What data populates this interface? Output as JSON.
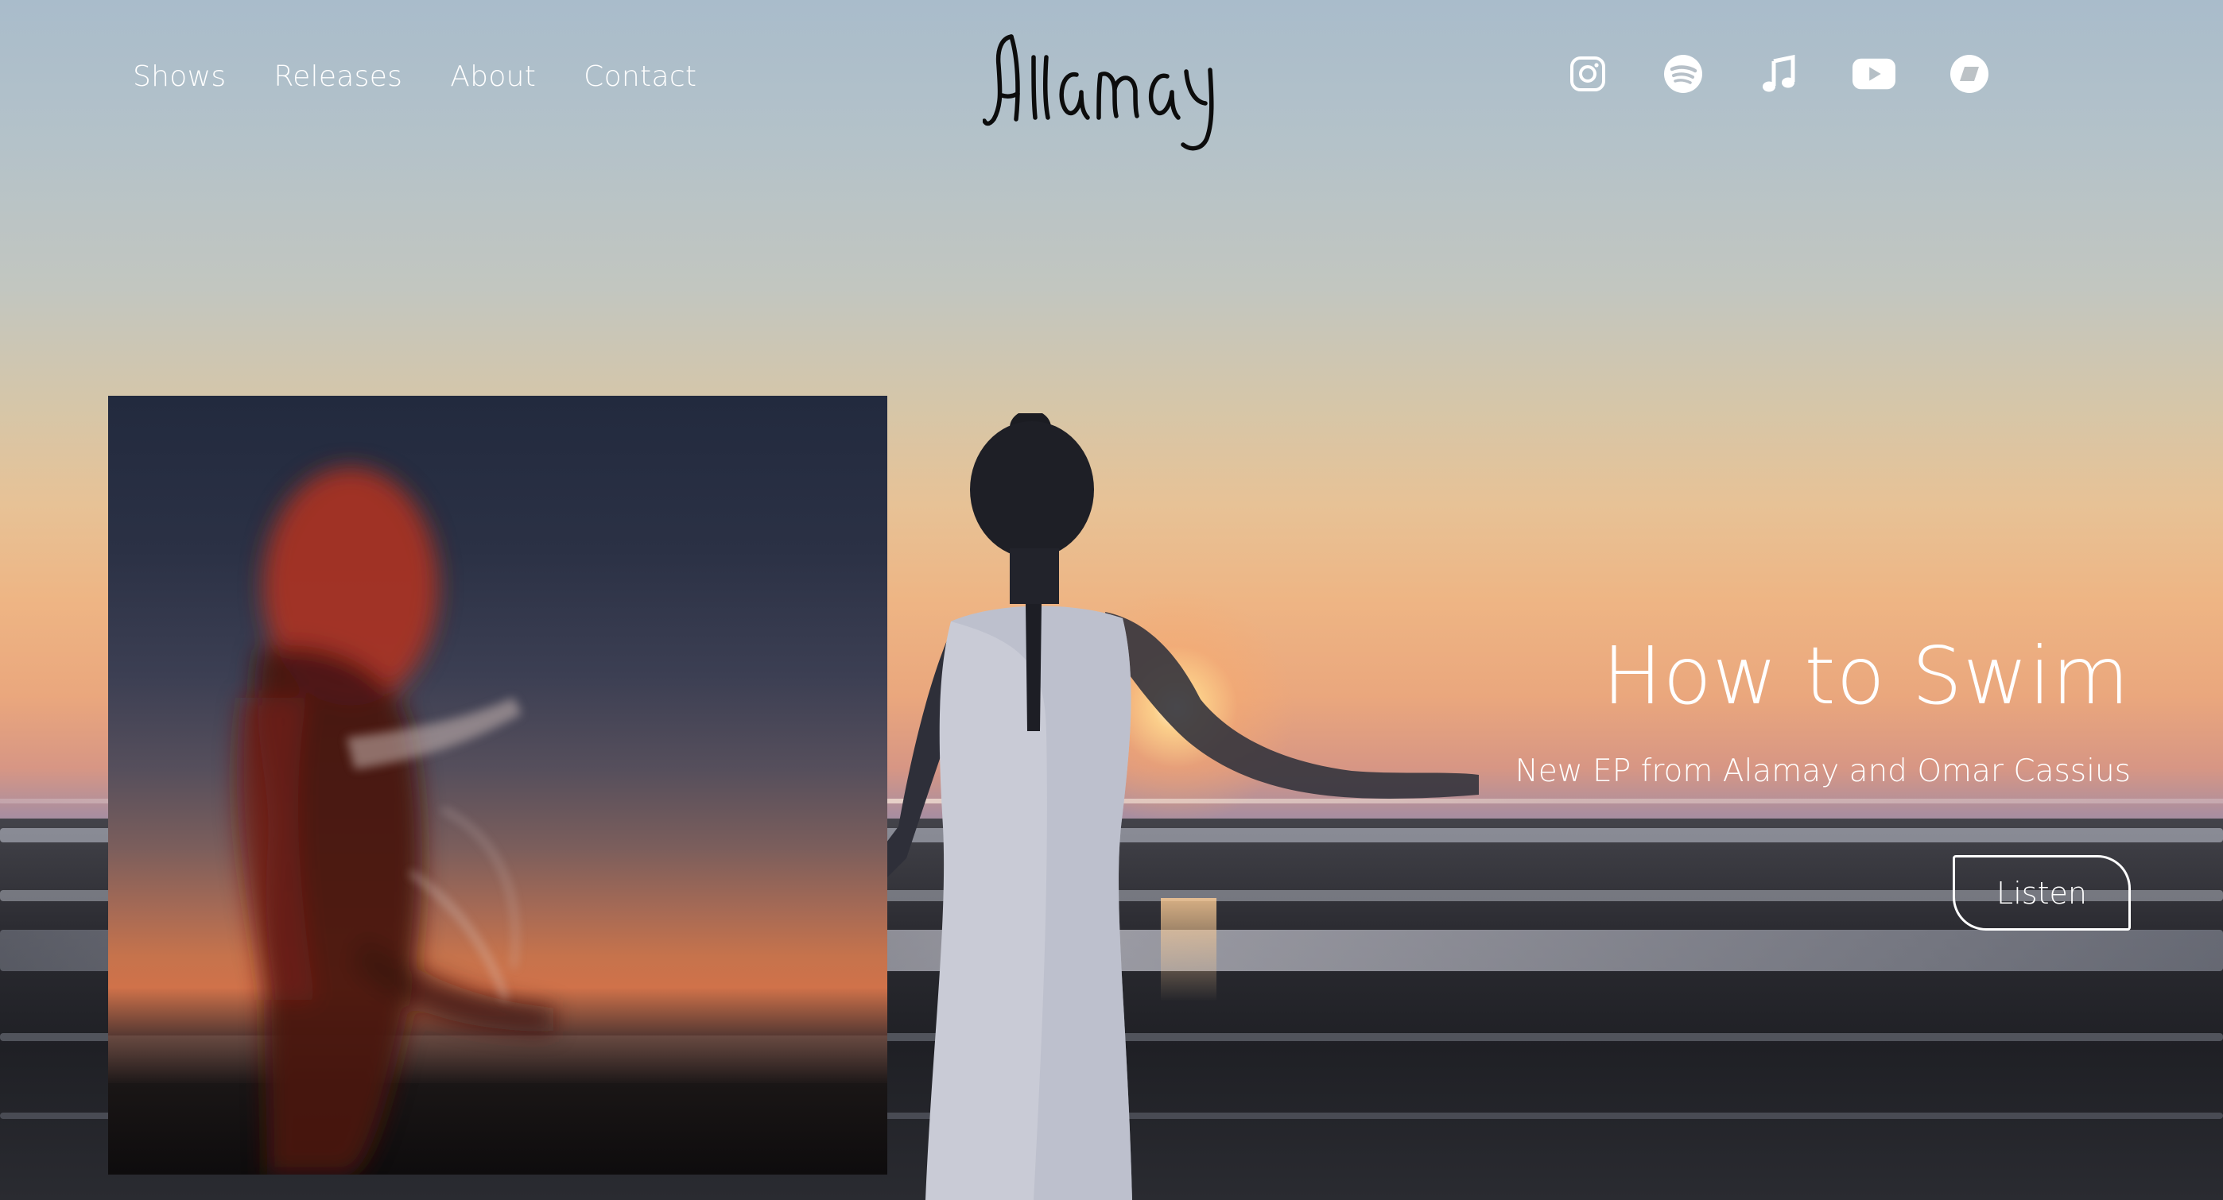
{
  "nav": {
    "items": [
      {
        "label": "Shows"
      },
      {
        "label": "Releases"
      },
      {
        "label": "About"
      },
      {
        "label": "Contact"
      }
    ]
  },
  "brand": {
    "logo_text": "Alamay"
  },
  "social": {
    "icons": [
      "instagram-icon",
      "spotify-icon",
      "apple-music-icon",
      "youtube-icon",
      "bandcamp-icon"
    ]
  },
  "hero": {
    "title": "How to Swim",
    "subtitle": "New EP from Alamay and Omar Cassius",
    "cta_label": "Listen"
  },
  "colors": {
    "text": "#ffffff",
    "sky_top": "#a9bccb",
    "sunset": "#eeb584",
    "sea": "#2b2b31"
  }
}
